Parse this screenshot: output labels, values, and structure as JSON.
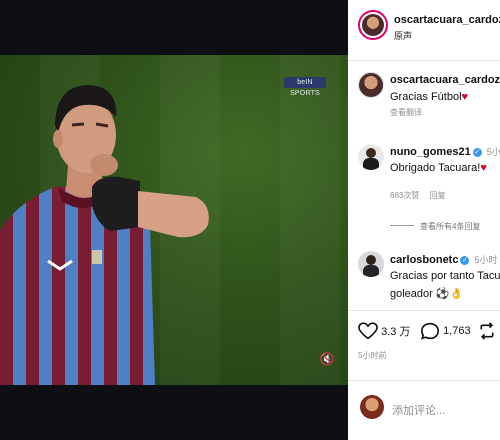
{
  "video": {
    "broadcaster_logo": "beIN SPORTS",
    "icons": {
      "mute": "speaker-icon"
    }
  },
  "post": {
    "author": {
      "username": "oscartacuara_cardozo",
      "subtitle": "原声"
    },
    "caption": {
      "username": "oscartacuara_cardozo",
      "text": "Gracias Fútbol",
      "emoji": "♥",
      "translate": "查看翻译"
    },
    "comments": [
      {
        "username": "nuno_gomes21",
        "time": "5小时",
        "text": "Obrigado Tacuara!",
        "emoji": "♥",
        "likes": "683次赞",
        "reply": "回复",
        "view_replies": "查看所有4条回复"
      },
      {
        "username": "carlosbonetc",
        "time": "5小时",
        "text_line1": "Gracias por tanto Tacu",
        "text_line2": "goleador ⚽👌"
      }
    ],
    "actions": {
      "likes": "3.3 万",
      "comments": "1,763",
      "time": "5小时前"
    },
    "add_comment_placeholder": "添加评论..."
  },
  "colors": {
    "heart": "#d9002b",
    "verified": "#3897f0",
    "ring": "#e4006a"
  }
}
